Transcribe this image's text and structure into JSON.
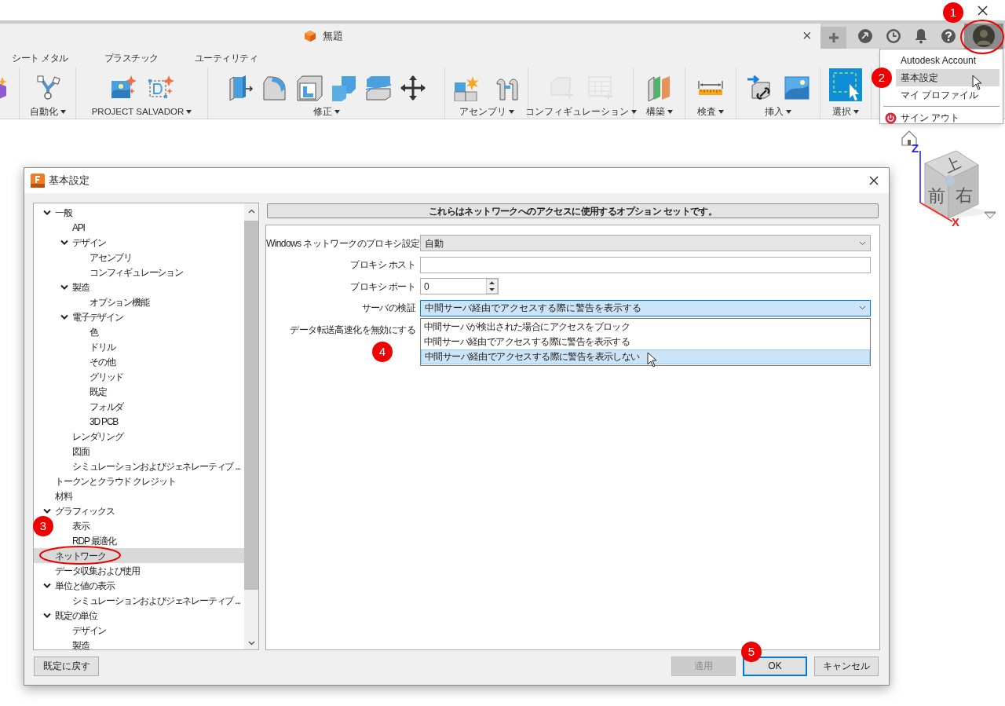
{
  "document_tab": {
    "title": "無題",
    "close": "×"
  },
  "toolbar_tabs": [
    {
      "label": "シート メタル"
    },
    {
      "label": "プラスチック"
    },
    {
      "label": "ユーティリティ"
    }
  ],
  "toolbar_groups": [
    {
      "kind": "partial"
    },
    {
      "label": "自動化",
      "disabled": false
    },
    {
      "label": "PROJECT SALVADOR",
      "disabled": false
    },
    {
      "label": "修正",
      "disabled": false
    },
    {
      "label": "アセンブリ",
      "disabled": false
    },
    {
      "label": "コンフィギュレーション",
      "disabled": true
    },
    {
      "label": "構築",
      "disabled": false
    },
    {
      "label": "検査",
      "disabled": false
    },
    {
      "label": "挿入",
      "disabled": false
    },
    {
      "label": "選択",
      "disabled": false
    }
  ],
  "account_menu": {
    "items": [
      {
        "label": "Autodesk Account",
        "selected": false,
        "kind": "item"
      },
      {
        "label": "基本設定",
        "selected": true,
        "kind": "item"
      },
      {
        "label": "マイ プロファイル",
        "selected": false,
        "kind": "item"
      },
      {
        "label": "サイン アウト",
        "selected": false,
        "kind": "signout"
      }
    ]
  },
  "view_cube": {
    "top": "上",
    "front": "前",
    "right": "右",
    "z_axis": "Z",
    "x_axis": "X"
  },
  "dialog": {
    "title": "基本設定",
    "tree": [
      {
        "label": "一般",
        "expanded": true,
        "selected": false,
        "children": [
          {
            "label": "API",
            "selected": false
          },
          {
            "label": "デザイン",
            "expanded": true,
            "selected": false,
            "children": [
              {
                "label": "アセンブリ",
                "selected": false
              },
              {
                "label": "コンフィギュレーション",
                "selected": false
              }
            ]
          },
          {
            "label": "製造",
            "expanded": true,
            "selected": false,
            "children": [
              {
                "label": "オプション機能",
                "selected": false
              }
            ]
          },
          {
            "label": "電子デザイン",
            "expanded": true,
            "selected": false,
            "children": [
              {
                "label": "色",
                "selected": false
              },
              {
                "label": "ドリル",
                "selected": false
              },
              {
                "label": "その他",
                "selected": false
              },
              {
                "label": "グリッド",
                "selected": false
              },
              {
                "label": "既定",
                "selected": false
              },
              {
                "label": "フォルダ",
                "selected": false
              },
              {
                "label": "3D PCB",
                "selected": false
              }
            ]
          },
          {
            "label": "レンダリング",
            "selected": false
          },
          {
            "label": "図面",
            "selected": false
          },
          {
            "label": "シミュレーションおよびジェネレーティブ ...",
            "selected": false
          }
        ]
      },
      {
        "label": "トークンとクラウド クレジット",
        "selected": false
      },
      {
        "label": "材料",
        "selected": false
      },
      {
        "label": "グラフィックス",
        "expanded": true,
        "selected": false,
        "children": [
          {
            "label": "表示",
            "selected": false
          },
          {
            "label": "RDP 最適化",
            "selected": false
          }
        ]
      },
      {
        "label": "ネットワーク",
        "selected": true
      },
      {
        "label": "データ収集および使用",
        "selected": false
      },
      {
        "label": "単位と値の表示",
        "expanded": true,
        "selected": false,
        "children": [
          {
            "label": "シミュレーションおよびジェネレーティブ ...",
            "selected": false
          }
        ]
      },
      {
        "label": "既定の単位",
        "expanded": true,
        "selected": false,
        "children": [
          {
            "label": "デザイン",
            "selected": false
          },
          {
            "label": "製造",
            "selected": false
          }
        ]
      }
    ],
    "description": "これらはネットワークへのアクセスに使用するオプション セットです。",
    "fields": [
      {
        "label": "Windows ネットワークのプロキシ設定",
        "kind": "select",
        "value": "自動",
        "open": false
      },
      {
        "label": "プロキシ ホスト",
        "kind": "text"
      },
      {
        "label": "プロキシ ポート",
        "kind": "spinner",
        "value": "0"
      },
      {
        "label": "サーバの検証",
        "kind": "select",
        "value": "中間サーバ経由でアクセスする際に警告を表示する",
        "open": true,
        "options": [
          {
            "label": "中間サーバが検出された場合にアクセスをブロック",
            "highlighted": false
          },
          {
            "label": "中間サーバ経由でアクセスする際に警告を表示する",
            "highlighted": false
          },
          {
            "label": "中間サーバ経由でアクセスする際に警告を表示しない",
            "highlighted": true
          }
        ]
      },
      {
        "label": "データ転送高速化を無効にする",
        "kind": "checkbox"
      }
    ],
    "reset_button": "既定に戻す",
    "buttons": [
      {
        "label": "適用",
        "disabled": true,
        "default": false
      },
      {
        "label": "OK",
        "disabled": false,
        "default": true
      },
      {
        "label": "キャンセル",
        "disabled": false,
        "default": false
      }
    ]
  },
  "annotations": [
    {
      "label": "1"
    },
    {
      "label": "2"
    },
    {
      "label": "3"
    },
    {
      "label": "4"
    },
    {
      "label": "5"
    }
  ]
}
